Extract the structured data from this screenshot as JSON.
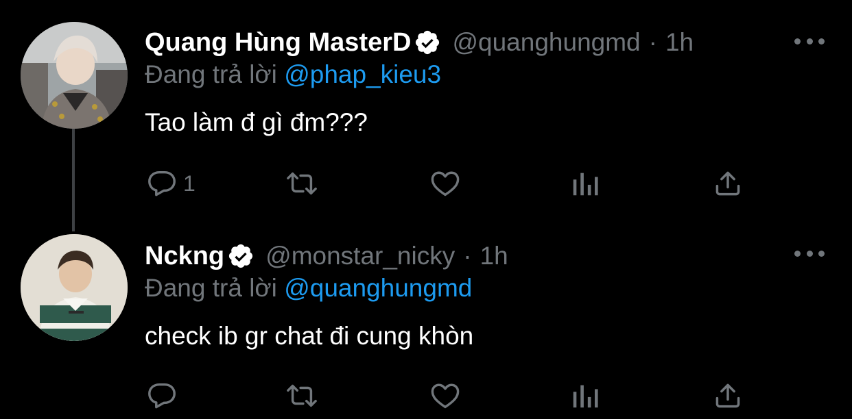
{
  "tweets": [
    {
      "display_name": "Quang Hùng MasterD",
      "handle": "@quanghungmd",
      "separator": "·",
      "time": "1h",
      "reply_prefix": "Đang trả lời",
      "reply_to": "@phap_kieu3",
      "text": "Tao làm đ gì đm???",
      "reply_count": "1",
      "verified": true
    },
    {
      "display_name": "Nckng",
      "handle": "@monstar_nicky",
      "separator": "·",
      "time": "1h",
      "reply_prefix": "Đang trả lời",
      "reply_to": "@quanghungmd",
      "text": "check ib gr chat đi cung khòn",
      "reply_count": "",
      "verified": true
    }
  ],
  "icons": {
    "more": "more-horizontal-icon",
    "reply": "reply-bubble-icon",
    "retweet": "retweet-icon",
    "like": "heart-icon",
    "views": "bar-chart-icon",
    "share": "share-upload-icon",
    "verified": "verified-badge-icon"
  },
  "colors": {
    "background": "#000000",
    "text_primary": "#ffffff",
    "text_secondary": "#71767b",
    "link": "#1d9bf0",
    "thread_line": "#3e4144"
  }
}
